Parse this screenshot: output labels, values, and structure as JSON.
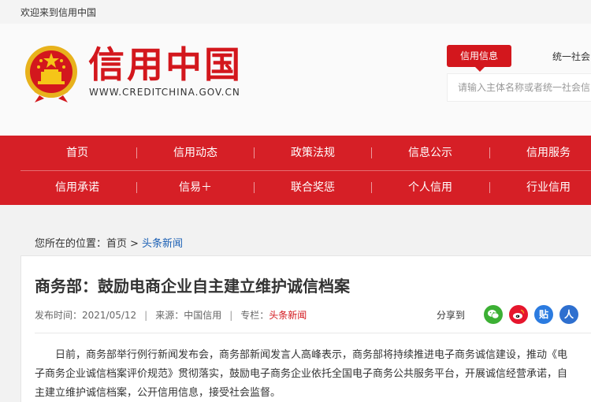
{
  "topbar": {
    "welcome": "欢迎来到信用中国"
  },
  "header": {
    "logo_text": "信用中国",
    "logo_url": "WWW.CREDITCHINA.GOV.CN",
    "search_tab_active": "信用信息",
    "search_tab_other": "统一社会",
    "search_placeholder": "请输入主体名称或者统一社会信"
  },
  "nav": {
    "row1": [
      "首页",
      "信用动态",
      "政策法规",
      "信息公示",
      "信用服务"
    ],
    "row2": [
      "信用承诺",
      "信易＋",
      "联合奖惩",
      "个人信用",
      "行业信用"
    ]
  },
  "breadcrumb": {
    "prefix": "您所在的位置：",
    "home": "首页",
    "separator": ">",
    "current": "头条新闻"
  },
  "article": {
    "title": "商务部：鼓励电商企业自主建立维护诚信档案",
    "publish_label": "发布时间：2021/05/12",
    "source_label": "来源：中国信用",
    "column_label": "专栏：",
    "column_value": "头条新闻",
    "meta_sep": "|",
    "share_label": "分享到",
    "share_icons": {
      "tieba_text": "贴",
      "renren_text": "人"
    },
    "body": "日前，商务部举行例行新闻发布会，商务部新闻发言人高峰表示，商务部将持续推进电子商务诚信建设，推动《电子商务企业诚信档案评价规范》贯彻落实，鼓励电子商务企业依托全国电子商务公共服务平台，开展诚信经营承诺，自主建立维护诚信档案，公开信用信息，接受社会监督。"
  },
  "colors": {
    "brand_red": "#d3171d",
    "nav_red": "#d61f26",
    "link_blue": "#1a5fb4",
    "wechat_green": "#3cb034",
    "weibo_red": "#e6162d",
    "tieba_blue": "#2b7be0",
    "renren_blue": "#2e6fcf"
  }
}
